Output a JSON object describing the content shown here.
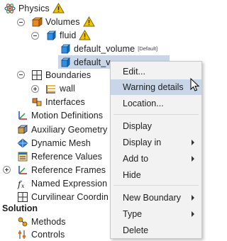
{
  "tree": {
    "physics": "Physics",
    "volumes": "Volumes",
    "fluid": "fluid",
    "default_volume": "default_volume",
    "default_volume_tag": "[Default]",
    "selected_volume": "default_v",
    "boundaries": "Boundaries",
    "wall": "wall",
    "interfaces": "Interfaces",
    "motion_definitions": "Motion Definitions",
    "auxiliary_geometry": "Auxiliary Geometry",
    "dynamic_mesh": "Dynamic Mesh",
    "reference_values": "Reference Values",
    "reference_frames": "Reference Frames",
    "named_expressions": "Named Expression",
    "curvilinear_coordinates": "Curvilinear Coordin",
    "solution": "Solution",
    "methods": "Methods",
    "controls": "Controls"
  },
  "context_menu": {
    "edit": "Edit...",
    "warning_details": "Warning details",
    "location": "Location...",
    "display": "Display",
    "display_in": "Display in",
    "add_to": "Add to",
    "hide": "Hide",
    "new_boundary": "New Boundary",
    "type": "Type",
    "delete": "Delete"
  },
  "colors": {
    "selection": "#c8d6e8",
    "warning": "#f2c400",
    "volume_blue": "#2f8fe0"
  }
}
